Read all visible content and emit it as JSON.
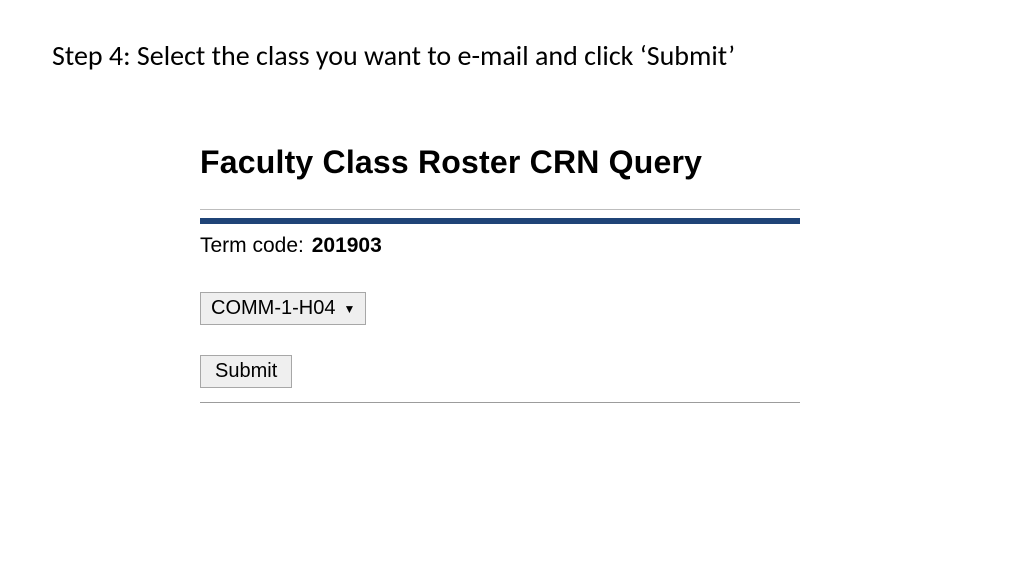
{
  "step_heading": "Step 4: Select the class you want to e-mail and click ‘Submit’",
  "panel": {
    "title": "Faculty Class Roster CRN Query",
    "term_label": "Term code:",
    "term_value": "201903",
    "class_select": {
      "selected": "COMM-1-H04"
    },
    "submit_label": "Submit"
  }
}
